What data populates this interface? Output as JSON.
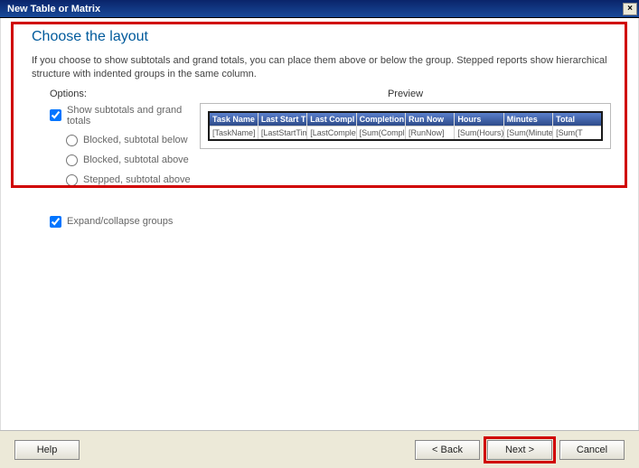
{
  "window": {
    "title": "New Table or Matrix",
    "close_glyph": "×"
  },
  "heading": "Choose the layout",
  "description": "If you choose to show subtotals and grand totals, you can place them above or below the group. Stepped reports show hierarchical structure with indented groups in the same column.",
  "options_label": "Options:",
  "preview_label": "Preview",
  "options": {
    "show_totals": "Show subtotals and grand totals",
    "blocked_below": "Blocked, subtotal below",
    "blocked_above": "Blocked, subtotal above",
    "stepped_above": "Stepped, subtotal above",
    "expand_collapse": "Expand/collapse groups"
  },
  "preview_table": {
    "headers": [
      "Task Name",
      "Last Start T",
      "Last Compl",
      "Completion",
      "Run Now",
      "Hours",
      "Minutes",
      "Total"
    ],
    "row": [
      "[TaskName]",
      "[LastStartTime]",
      "[LastCompletion",
      "[Sum(Completic",
      "[RunNow]",
      "[Sum(Hours)]",
      "[Sum(Minutes)]",
      "[Sum(T"
    ]
  },
  "buttons": {
    "help": "Help",
    "back": "< Back",
    "next": "Next >",
    "cancel": "Cancel"
  }
}
